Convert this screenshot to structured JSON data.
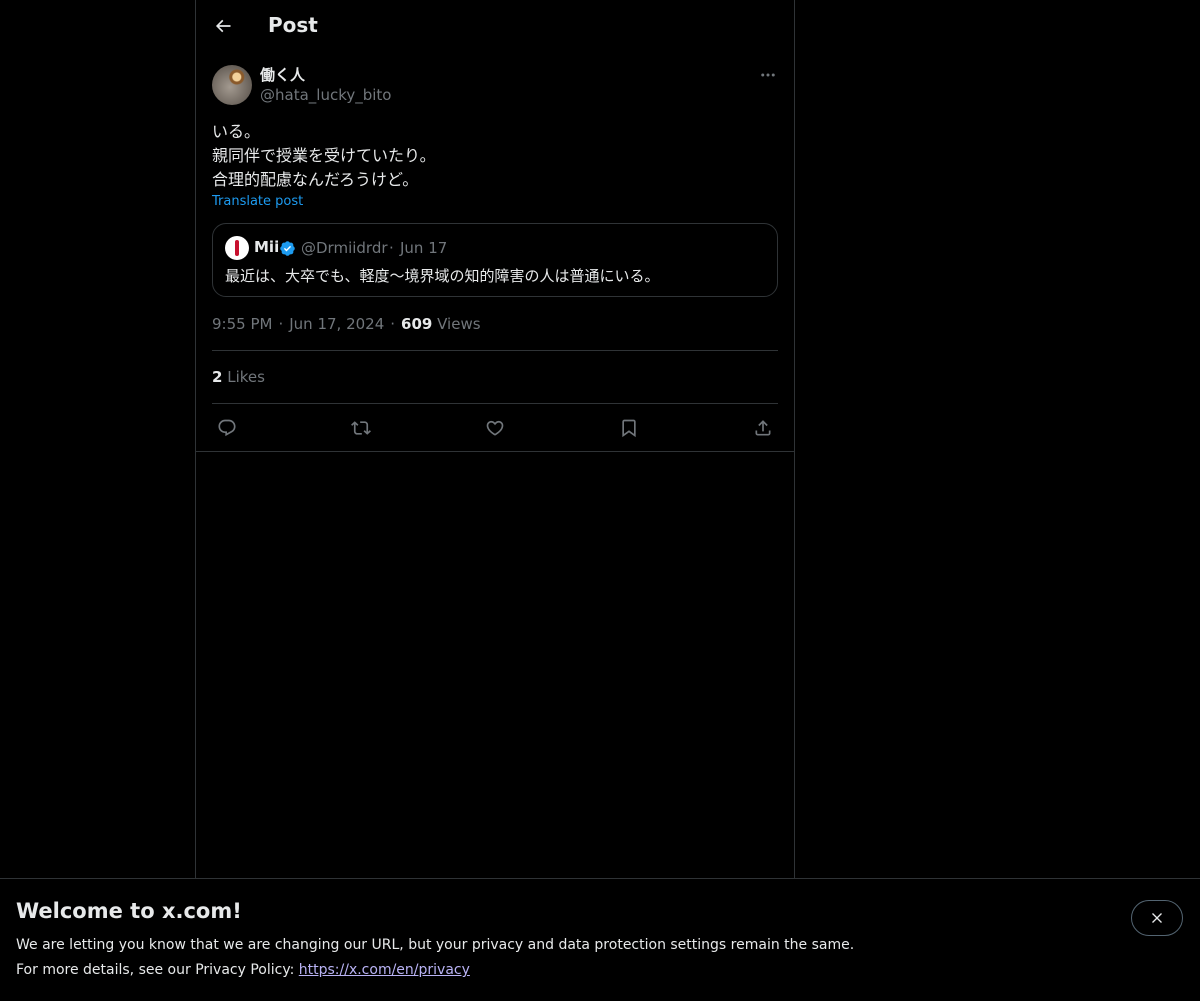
{
  "header": {
    "title": "Post"
  },
  "post": {
    "author_name": "働く人",
    "author_handle": "@hata_lucky_bito",
    "text_lines": [
      "いる。",
      "親同伴で授業を受けていたり。",
      "合理的配慮なんだろうけど。"
    ],
    "translate_label": "Translate post",
    "quote": {
      "name": "Mii",
      "handle": "@Drmiidrdr",
      "separator": "·",
      "date": "Jun 17",
      "text": "最近は、大卒でも、軽度〜境界域の知的障害の人は普通にいる。"
    },
    "time": "9:55 PM",
    "date": "Jun 17, 2024",
    "separator": "·",
    "views_count": "609",
    "views_label": "Views",
    "likes_count": "2",
    "likes_label": "Likes"
  },
  "actions": {
    "icons": [
      "reply-icon",
      "repost-icon",
      "like-icon",
      "bookmark-icon",
      "share-icon"
    ]
  },
  "banner": {
    "title": "Welcome to x.com!",
    "line1": "We are letting you know that we are changing our URL, but your privacy and data protection settings remain the same.",
    "line2_prefix": "For more details, see our Privacy Policy:",
    "link": "https://x.com/en/privacy"
  },
  "colors": {
    "background": "#000000",
    "text": "#e7e9ea",
    "muted": "#71767b",
    "accent": "#1d9bf0",
    "border": "#2f3336",
    "link_visited": "#b9b3f5"
  }
}
